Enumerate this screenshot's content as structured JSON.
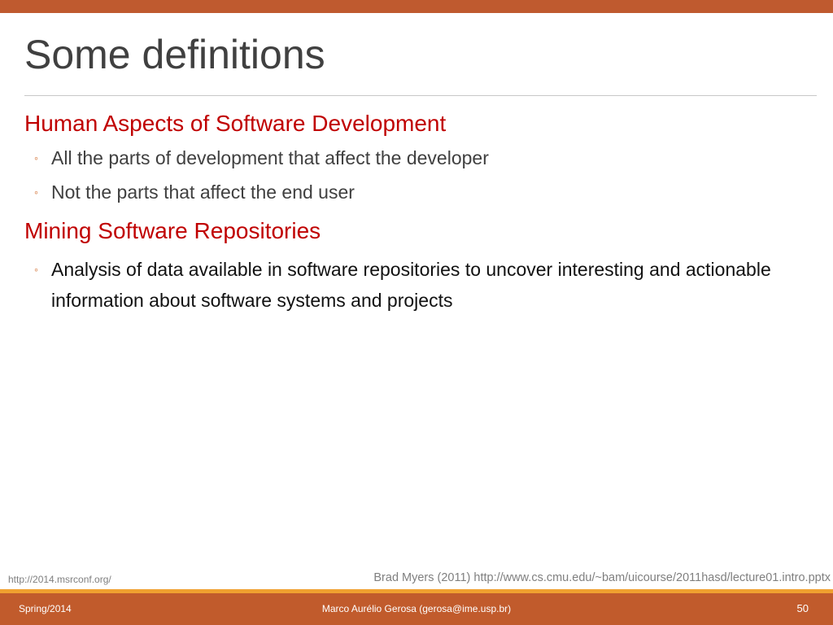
{
  "slide": {
    "title": "Some definitions",
    "sections": [
      {
        "heading": "Human Aspects of Software Development",
        "bullets": [
          "All the parts of development that affect the developer",
          "Not the parts that affect the end user"
        ]
      },
      {
        "heading": "Mining Software Repositories",
        "bullets": [
          "Analysis of data available in software repositories to uncover interesting and actionable information about software systems and projects"
        ]
      }
    ],
    "bullet_glyph": "◦",
    "credit_left": "http://2014.msrconf.org/",
    "credit_right": "Brad Myers (2011) http://www.cs.cmu.edu/~bam/uicourse/2011hasd/lecture01.intro.pptx"
  },
  "footer": {
    "left": "Spring/2014",
    "center": "Marco Aurélio Gerosa (gerosa@ime.usp.br)",
    "page_number": "50"
  },
  "colors": {
    "accent": "#bf5a2f",
    "heading": "#c00000",
    "footer_stripe": "#f0a030"
  }
}
